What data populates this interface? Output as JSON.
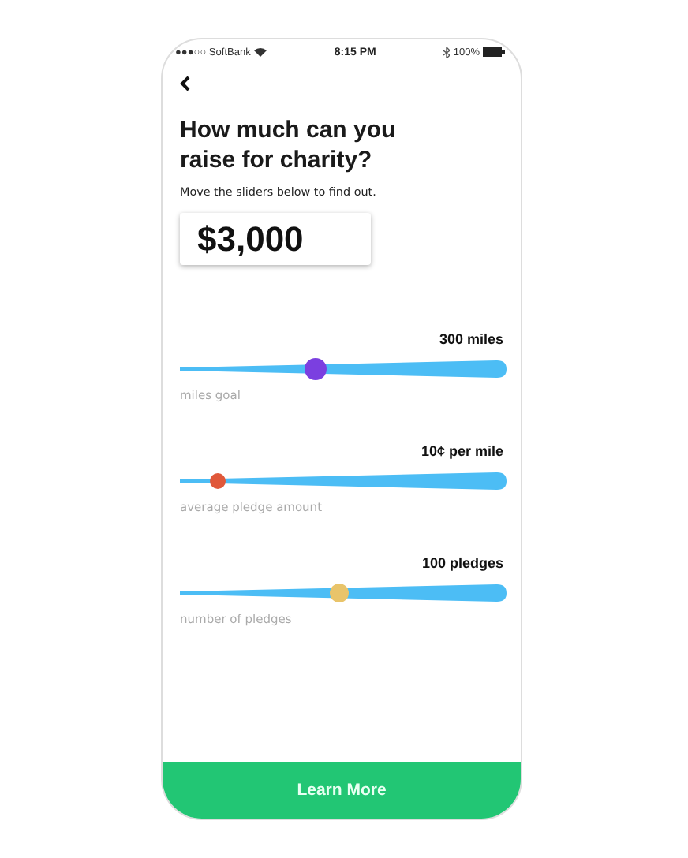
{
  "status_bar": {
    "carrier": "●●●○○ SoftBank",
    "time": "8:15 PM",
    "battery": "100%"
  },
  "title": "How much can you raise for charity?",
  "subtitle": "Move the sliders below to find out.",
  "total": "$3,000",
  "sliders": [
    {
      "reading": "300 miles",
      "label": "miles goal",
      "level": 0.415,
      "color": "#7b3fe0"
    },
    {
      "reading": "10¢ per mile",
      "label": "average pledge amount",
      "level": 0.116,
      "color": "#e0583a"
    },
    {
      "reading": "100 pledges",
      "label": "number of pledges",
      "level": 0.49,
      "color": "#e9c46a"
    }
  ],
  "button": "Learn More"
}
